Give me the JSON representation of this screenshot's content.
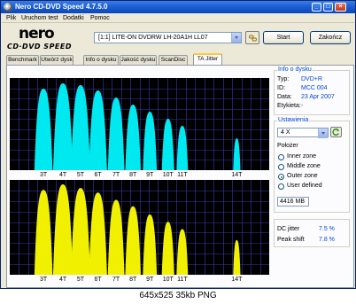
{
  "window": {
    "title": "Nero CD-DVD Speed 4.7.5.0"
  },
  "menu": [
    "Plik",
    "Uruchom test",
    "Dodatki",
    "Pomoc"
  ],
  "logo": {
    "brand": "nero",
    "product": "CD·DVD SPEED"
  },
  "drive": {
    "selected": "[1:1]  LITE-ON DVDRW LH-20A1H LL07"
  },
  "buttons": {
    "start": "Start",
    "cancel": "Zakończ"
  },
  "tabs": [
    "Benchmark",
    "Utwórz dysk",
    "Info o dysku",
    "Jakość dysku",
    "ScanDisc",
    "TA Jitter"
  ],
  "active_tab": "TA Jitter",
  "info": {
    "title": "Info o dysku",
    "rows": [
      {
        "key": "Typ:",
        "value": "DVD+R"
      },
      {
        "key": "ID:",
        "value": "MCC 004"
      },
      {
        "key": "Data:",
        "value": "23 Apr 2007"
      },
      {
        "key": "Etykieta:",
        "value": "-"
      }
    ]
  },
  "settings": {
    "title": "Ustawienia",
    "speed": "4 X",
    "position_label": "Położer",
    "zones": [
      "Inner zone",
      "Middle zone",
      "Outer zone",
      "User defined"
    ],
    "selected_zone": "Outer zone",
    "size": "4416 MB"
  },
  "stats": [
    {
      "key": "DC jitter",
      "value": "7.5 %"
    },
    {
      "key": "Peak shift",
      "value": "7.8 %"
    }
  ],
  "caption": "645x525  35kb  PNG",
  "colors": {
    "top_peaks": "#00e8f0",
    "bottom_peaks": "#f0f000",
    "grid": "#3a3ab8",
    "graph_bg": "#000000"
  },
  "chart_data": [
    {
      "type": "area",
      "title": "",
      "categories": [
        "3T",
        "4T",
        "5T",
        "6T",
        "7T",
        "8T",
        "9T",
        "10T",
        "11T",
        "14T"
      ],
      "series": [],
      "values": [
        0.92,
        0.98,
        0.96,
        0.9,
        0.82,
        0.74,
        0.66,
        0.58,
        0.5,
        0.36
      ]
    },
    {
      "type": "area",
      "title": "",
      "categories": [
        "3T",
        "4T",
        "5T",
        "6T",
        "7T",
        "8T",
        "9T",
        "10T",
        "11T",
        "14T"
      ],
      "series": [],
      "values": [
        0.93,
        0.99,
        0.95,
        0.9,
        0.82,
        0.75,
        0.66,
        0.58,
        0.5,
        0.38
      ]
    }
  ]
}
